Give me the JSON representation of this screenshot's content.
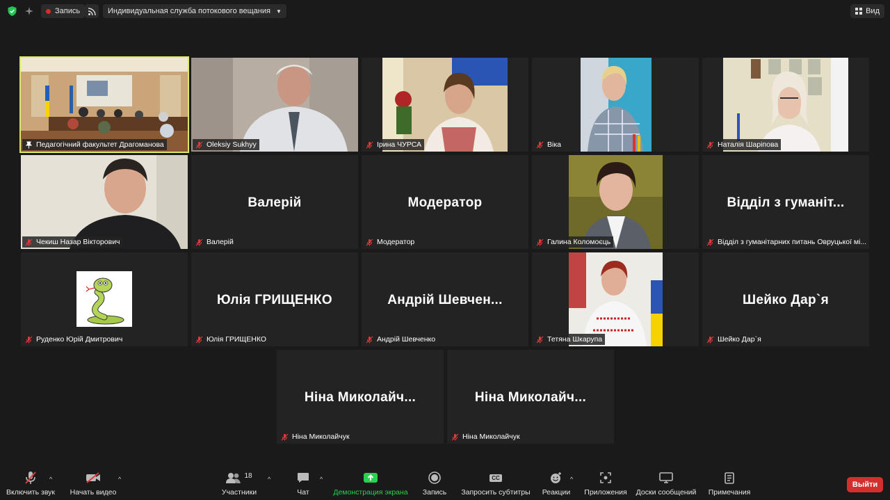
{
  "topbar": {
    "recording_label": "Запись",
    "stream_label": "Индивидуальная служба потокового вещания",
    "view_label": "Вид"
  },
  "tiles": [
    {
      "label": "Педагогічний факультет Драгоманова",
      "big": ""
    },
    {
      "label": "Oleksiy Sukhyy",
      "big": ""
    },
    {
      "label": "Ірина ЧУРСА",
      "big": ""
    },
    {
      "label": "Віка",
      "big": ""
    },
    {
      "label": "Наталія Шаріпова",
      "big": ""
    },
    {
      "label": "Чекиш Назар Вікторович",
      "big": ""
    },
    {
      "label": "Валерій",
      "big": "Валерій"
    },
    {
      "label": "Модератор",
      "big": "Модератор"
    },
    {
      "label": "Галина Коломоєць",
      "big": ""
    },
    {
      "label": "Відділ з гуманітарних питань Овруцької мі...",
      "big": "Відділ з гуманіт..."
    },
    {
      "label": "Руденко Юрій Дмитрович",
      "big": ""
    },
    {
      "label": "Юлія ГРИЩЕНКО",
      "big": "Юлія ГРИЩЕНКО"
    },
    {
      "label": "Андрій Шевченко",
      "big": "Андрій Шевчен..."
    },
    {
      "label": "Тетяна Шкарупа",
      "big": ""
    },
    {
      "label": "Шейко Дар`я",
      "big": "Шейко Дар`я"
    },
    {
      "label": "Ніна Миколайчук",
      "big": "Ніна Миколайч..."
    },
    {
      "label": "Ніна Миколайчук",
      "big": "Ніна Миколайч..."
    }
  ],
  "toolbar": {
    "audio": "Включить звук",
    "video": "Начать видео",
    "participants": "Участники",
    "participants_count": "18",
    "chat": "Чат",
    "share": "Демонстрация экрана",
    "record": "Запись",
    "captions": "Запросить субтитры",
    "captions_icon_text": "CC",
    "reactions": "Реакции",
    "apps": "Приложения",
    "whiteboards": "Доски сообщений",
    "notes": "Примечания",
    "leave": "Выйти"
  },
  "colors": {
    "active_speaker_outline": "#d9e86a",
    "share_green": "#2ad04f",
    "leave_red": "#d42f2f",
    "mic_muted_red": "#e03a3a"
  }
}
